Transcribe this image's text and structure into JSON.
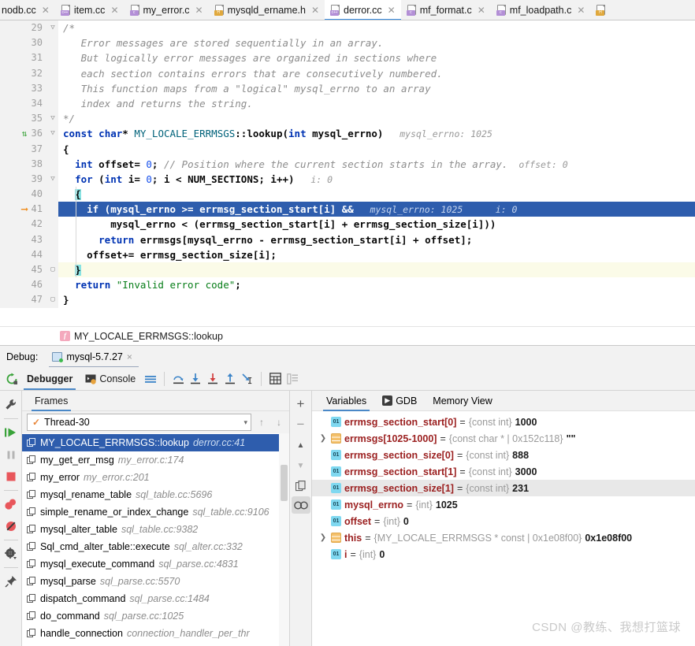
{
  "window": {
    "watermark": "CSDN @教练、我想打篮球"
  },
  "tabs": [
    {
      "label": "nodb.cc",
      "kind": "cpp",
      "tag": "c++",
      "active": false,
      "closable": true
    },
    {
      "label": "item.cc",
      "kind": "cpp",
      "tag": "c++",
      "active": false,
      "closable": true
    },
    {
      "label": "my_error.c",
      "kind": "c",
      "tag": "c",
      "active": false,
      "closable": true
    },
    {
      "label": "mysqld_ername.h",
      "kind": "h",
      "tag": "H",
      "active": false,
      "closable": true
    },
    {
      "label": "derror.cc",
      "kind": "cpp",
      "tag": "c++",
      "active": true,
      "closable": true
    },
    {
      "label": "mf_format.c",
      "kind": "c",
      "tag": "c",
      "active": false,
      "closable": true
    },
    {
      "label": "mf_loadpath.c",
      "kind": "c",
      "tag": "c",
      "active": false,
      "closable": true
    }
  ],
  "editor": {
    "file": "derror.cc",
    "lines": [
      {
        "num": "29",
        "fold": "minus",
        "marker": "",
        "state": "",
        "html": "<span class=\"cm\">/*</span>"
      },
      {
        "num": "30",
        "fold": "",
        "marker": "",
        "state": "",
        "html": "<span class=\"cm\">   Error messages are stored sequentially in an array.</span>"
      },
      {
        "num": "31",
        "fold": "",
        "marker": "",
        "state": "",
        "html": "<span class=\"cm\">   But logically error messages are organized in sections where</span>"
      },
      {
        "num": "32",
        "fold": "",
        "marker": "",
        "state": "",
        "html": "<span class=\"cm\">   each section contains errors that are consecutively numbered.</span>"
      },
      {
        "num": "33",
        "fold": "",
        "marker": "",
        "state": "",
        "html": "<span class=\"cm\">   This function maps from a \"logical\" mysql_errno to an array</span>"
      },
      {
        "num": "34",
        "fold": "",
        "marker": "",
        "state": "",
        "html": "<span class=\"cm\">   index and returns the string.</span>"
      },
      {
        "num": "35",
        "fold": "minus",
        "marker": "",
        "state": "",
        "html": "<span class=\"cm\">*/</span>"
      },
      {
        "num": "36",
        "fold": "minus",
        "marker": "override",
        "state": "",
        "html": "<span class=\"kw\">const</span> <span class=\"kw\">char</span><span class=\"bold\">*</span> <span class=\"fn\">MY_LOCALE_ERRMSGS</span><span class=\"bold\">::lookup(</span><span class=\"kw\">int</span><span class=\"bold\"> mysql_errno)</span><span class=\"hint\">   mysql_errno: 1025</span>"
      },
      {
        "num": "37",
        "fold": "",
        "marker": "",
        "state": "",
        "html": "<span class=\"bold\">{</span>"
      },
      {
        "num": "38",
        "fold": "",
        "marker": "",
        "state": "",
        "html": "  <span class=\"kw\">int</span><span class=\"bold\"> offset= </span><span class=\"num\">0</span><span class=\"bold\">;</span> <span class=\"cm\">// Position where the current section starts in the array.</span><span class=\"hint\">  offset: 0</span>"
      },
      {
        "num": "39",
        "fold": "minus",
        "marker": "",
        "state": "",
        "html": "  <span class=\"kw\">for</span><span class=\"bold\"> (</span><span class=\"kw\">int</span><span class=\"bold\"> i= </span><span class=\"num\">0</span><span class=\"bold\">; i &lt; NUM_SECTIONS; i++)</span><span class=\"hint\">   i: 0</span>"
      },
      {
        "num": "40",
        "fold": "",
        "marker": "",
        "state": "",
        "html": "  <span class=\"caret\"></span><span class=\"bold\">{</span>"
      },
      {
        "num": "41",
        "fold": "",
        "marker": "arrow",
        "state": "hl",
        "html": "    <span class=\"bold\">if (mysql_errno &gt;= errmsg_section_start[i] &amp;&amp;</span><span class=\"hint\">   mysql_errno: 1025      i: 0</span>"
      },
      {
        "num": "42",
        "fold": "",
        "marker": "",
        "state": "",
        "html": "        <span class=\"bold\">mysql_errno &lt; (errmsg_section_start[i] + errmsg_section_size[i]))</span>"
      },
      {
        "num": "43",
        "fold": "",
        "marker": "",
        "state": "",
        "html": "      <span class=\"kw\">return</span><span class=\"bold\"> errmsgs[mysql_errno - errmsg_section_start[i] + offset];</span>"
      },
      {
        "num": "44",
        "fold": "",
        "marker": "",
        "state": "",
        "html": "    <span class=\"bold\">offset+= errmsg_section_size[i];</span>"
      },
      {
        "num": "45",
        "fold": "lock",
        "marker": "",
        "state": "yellow",
        "html": "  <span class=\"caret\"></span><span class=\"bold\">}</span>"
      },
      {
        "num": "46",
        "fold": "",
        "marker": "",
        "state": "",
        "html": "  <span class=\"kw\">return</span> <span class=\"str\">\"Invalid error code\"</span><span class=\"bold\">;</span>"
      },
      {
        "num": "47",
        "fold": "lock",
        "marker": "",
        "state": "",
        "html": "<span class=\"bold\">}</span>"
      }
    ]
  },
  "breadcrumb": {
    "icon": "function-icon",
    "icon_letter": "f",
    "label": "MY_LOCALE_ERRMSGS::lookup"
  },
  "debug_header": {
    "label": "Debug:",
    "run_config": "mysql-5.7.27",
    "close": "×"
  },
  "debug_toolbar": {
    "rerun_icon": "rerun-icon",
    "tabs": [
      {
        "label": "Debugger",
        "selected": true,
        "icon": ""
      },
      {
        "label": "Console",
        "selected": false,
        "icon": "console-icon"
      }
    ],
    "buttons": [
      {
        "name": "layout-icon",
        "title": "Layout"
      },
      {
        "name": "step-over-icon",
        "title": "Step Over"
      },
      {
        "name": "step-into-icon",
        "title": "Step Into"
      },
      {
        "name": "force-step-into-icon",
        "title": "Force Step Into"
      },
      {
        "name": "step-out-icon",
        "title": "Step Out"
      },
      {
        "name": "run-to-cursor-icon",
        "title": "Run to Cursor"
      },
      {
        "name": "evaluate-icon",
        "title": "Evaluate Expression"
      },
      {
        "name": "variables-view-icon",
        "title": "Variables View"
      }
    ]
  },
  "left_rail": [
    {
      "name": "settings-wrench-icon"
    },
    {
      "name": "resume-program-icon"
    },
    {
      "name": "pause-program-icon"
    },
    {
      "name": "stop-program-icon"
    },
    {
      "name": "view-breakpoints-icon"
    },
    {
      "name": "mute-breakpoints-icon"
    },
    {
      "name": "settings-gear-icon"
    },
    {
      "name": "pin-tab-icon"
    }
  ],
  "frames": {
    "header": "Frames",
    "thread": {
      "value": "Thread-30",
      "check": "✓",
      "arrow": "▾"
    },
    "nav": {
      "up": "↑",
      "down": "↓"
    },
    "items": [
      {
        "fn": "MY_LOCALE_ERRMSGS::lookup",
        "loc": "derror.cc:41",
        "selected": true
      },
      {
        "fn": "my_get_err_msg",
        "loc": "my_error.c:174",
        "selected": false
      },
      {
        "fn": "my_error",
        "loc": "my_error.c:201",
        "selected": false
      },
      {
        "fn": "mysql_rename_table",
        "loc": "sql_table.cc:5696",
        "selected": false
      },
      {
        "fn": "simple_rename_or_index_change",
        "loc": "sql_table.cc:9106",
        "selected": false
      },
      {
        "fn": "mysql_alter_table",
        "loc": "sql_table.cc:9382",
        "selected": false
      },
      {
        "fn": "Sql_cmd_alter_table::execute",
        "loc": "sql_alter.cc:332",
        "selected": false
      },
      {
        "fn": "mysql_execute_command",
        "loc": "sql_parse.cc:4831",
        "selected": false
      },
      {
        "fn": "mysql_parse",
        "loc": "sql_parse.cc:5570",
        "selected": false
      },
      {
        "fn": "dispatch_command",
        "loc": "sql_parse.cc:1484",
        "selected": false
      },
      {
        "fn": "do_command",
        "loc": "sql_parse.cc:1025",
        "selected": false
      },
      {
        "fn": "handle_connection",
        "loc": "connection_handler_per_thr",
        "selected": false
      }
    ]
  },
  "mid_rail": [
    {
      "name": "add-watch-icon",
      "glyph": "+"
    },
    {
      "name": "remove-watch-icon",
      "glyph": "−"
    },
    {
      "name": "move-up-icon",
      "glyph": "▲"
    },
    {
      "name": "move-down-icon",
      "glyph": "▼"
    },
    {
      "name": "copy-value-icon",
      "glyph": ""
    },
    {
      "name": "inspect-icon",
      "glyph": ""
    }
  ],
  "variables": {
    "tabs": [
      {
        "label": "Variables",
        "selected": true,
        "icon": ""
      },
      {
        "label": "GDB",
        "selected": false,
        "icon": "gdb-icon"
      },
      {
        "label": "Memory View",
        "selected": false,
        "icon": ""
      }
    ],
    "rows": [
      {
        "expand": "",
        "icon": "int",
        "name": "errmsg_section_start[0]",
        "eq": " = ",
        "type": "{const int}",
        "value": "1000",
        "selected": false
      },
      {
        "expand": ">",
        "icon": "array",
        "name": "errmsgs[1025-1000]",
        "eq": " = ",
        "type": "{const char * | 0x152c118}",
        "value": "\"\"",
        "selected": false
      },
      {
        "expand": "",
        "icon": "int",
        "name": "errmsg_section_size[0]",
        "eq": " = ",
        "type": "{const int}",
        "value": "888",
        "selected": false
      },
      {
        "expand": "",
        "icon": "int",
        "name": "errmsg_section_start[1]",
        "eq": " = ",
        "type": "{const int}",
        "value": "3000",
        "selected": false
      },
      {
        "expand": "",
        "icon": "int",
        "name": "errmsg_section_size[1]",
        "eq": " = ",
        "type": "{const int}",
        "value": "231",
        "selected": true
      },
      {
        "expand": "",
        "icon": "int",
        "name": "mysql_errno",
        "eq": " = ",
        "type": "{int}",
        "value": "1025",
        "selected": false
      },
      {
        "expand": "",
        "icon": "int",
        "name": "offset",
        "eq": " = ",
        "type": "{int}",
        "value": "0",
        "selected": false
      },
      {
        "expand": ">",
        "icon": "array",
        "name": "this",
        "eq": " = ",
        "type": "{MY_LOCALE_ERRMSGS * const | 0x1e08f00}",
        "value": "0x1e08f00",
        "selected": false
      },
      {
        "expand": "",
        "icon": "int",
        "name": "i",
        "eq": " = ",
        "type": "{int}",
        "value": "0",
        "selected": false
      }
    ]
  }
}
